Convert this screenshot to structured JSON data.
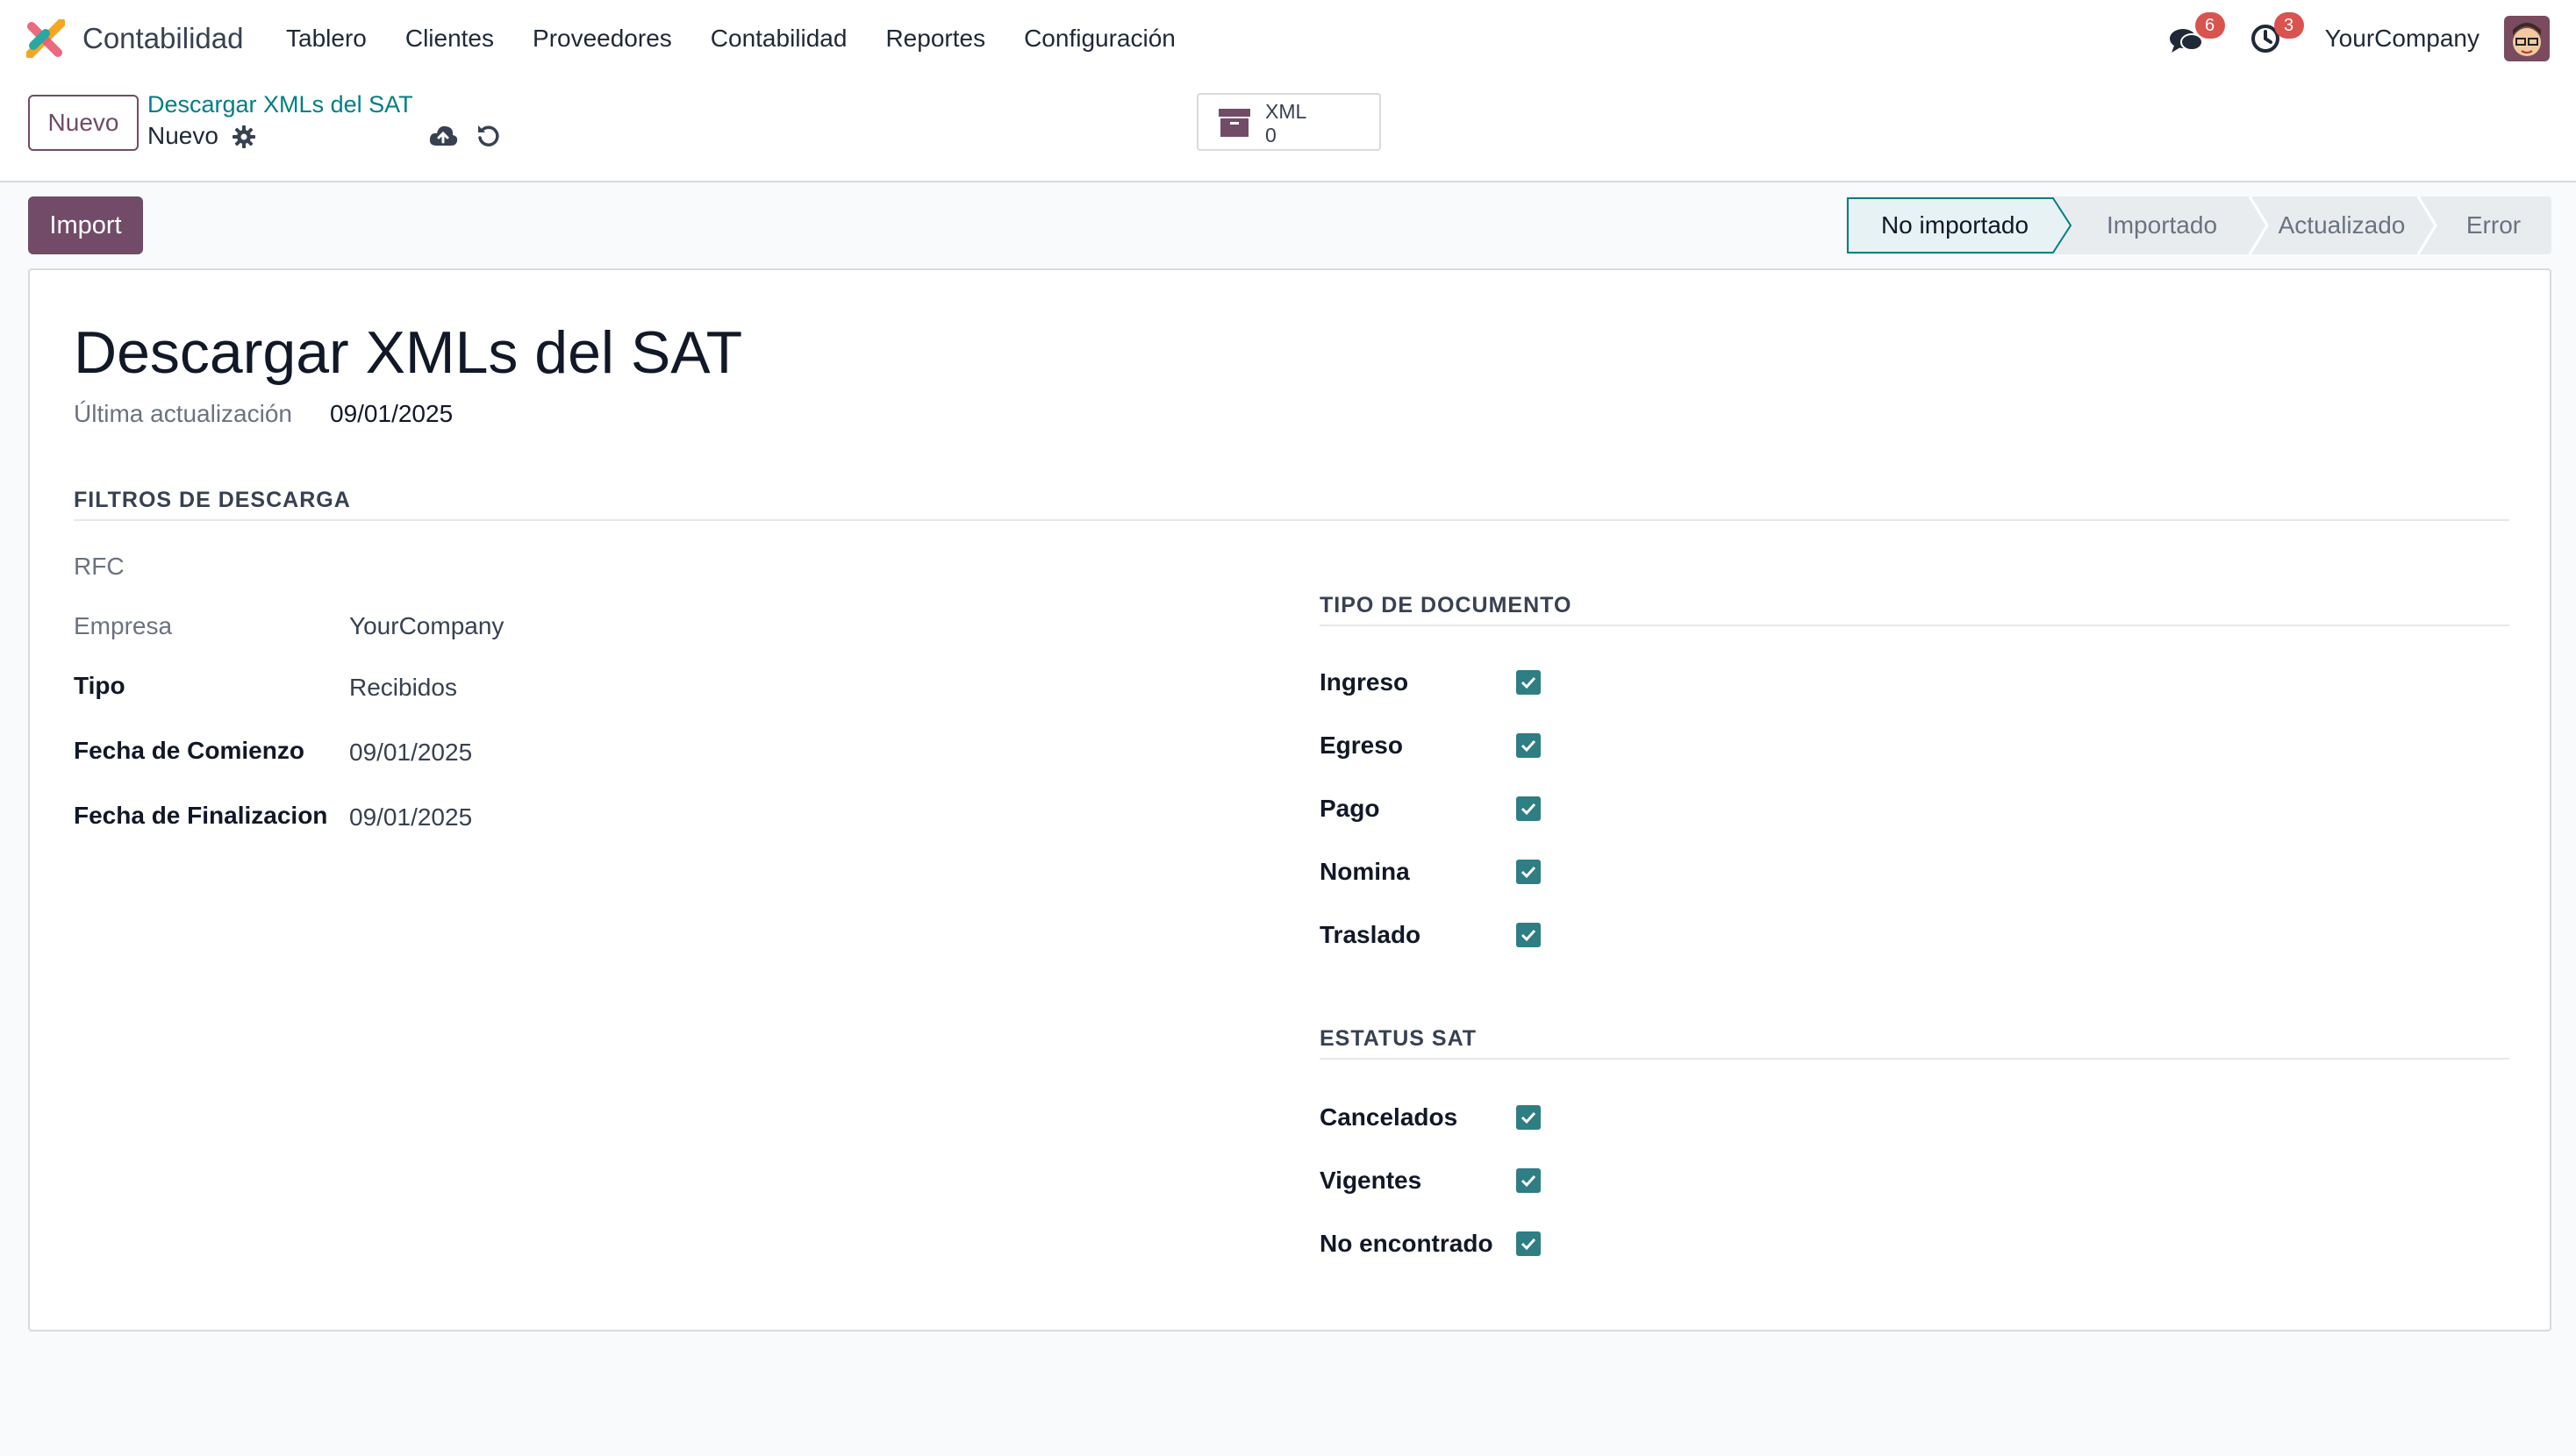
{
  "app": {
    "name": "Contabilidad",
    "company": "YourCompany"
  },
  "menu": [
    {
      "label": "Tablero"
    },
    {
      "label": "Clientes"
    },
    {
      "label": "Proveedores"
    },
    {
      "label": "Contabilidad"
    },
    {
      "label": "Reportes"
    },
    {
      "label": "Configuración"
    }
  ],
  "systray": {
    "messages_count": "6",
    "activities_count": "3"
  },
  "control": {
    "new_label": "Nuevo",
    "breadcrumb": "Descargar XMLs del SAT",
    "record_name": "Nuevo",
    "smart_button": {
      "label": "XML",
      "count": "0"
    }
  },
  "actions": {
    "import_label": "Import"
  },
  "status_stages": [
    {
      "label": "No importado",
      "active": true
    },
    {
      "label": "Importado",
      "active": false
    },
    {
      "label": "Actualizado",
      "active": false
    },
    {
      "label": "Error",
      "active": false
    }
  ],
  "form": {
    "title": "Descargar XMLs del SAT",
    "last_update_label": "Última actualización",
    "last_update_value": "09/01/2025",
    "filters_section": "FILTROS DE DESCARGA",
    "rfc_label": "RFC",
    "company_label": "Empresa",
    "company_value": "YourCompany",
    "type_label": "Tipo",
    "type_value": "Recibidos",
    "start_label": "Fecha de Comienzo",
    "start_value": "09/01/2025",
    "end_label": "Fecha de Finalizacion",
    "end_value": "09/01/2025",
    "doc_type_section": "TIPO DE DOCUMENTO",
    "doc_types": [
      {
        "label": "Ingreso",
        "checked": true
      },
      {
        "label": "Egreso",
        "checked": true
      },
      {
        "label": "Pago",
        "checked": true
      },
      {
        "label": "Nomina",
        "checked": true
      },
      {
        "label": "Traslado",
        "checked": true
      }
    ],
    "sat_status_section": "ESTATUS SAT",
    "sat_status": [
      {
        "label": "Cancelados",
        "checked": true
      },
      {
        "label": "Vigentes",
        "checked": true
      },
      {
        "label": "No encontrado",
        "checked": true
      }
    ]
  },
  "colors": {
    "brand": "#714b67",
    "accent": "#017e84",
    "checkbox": "#2e7e84",
    "badge": "#d9534f"
  }
}
